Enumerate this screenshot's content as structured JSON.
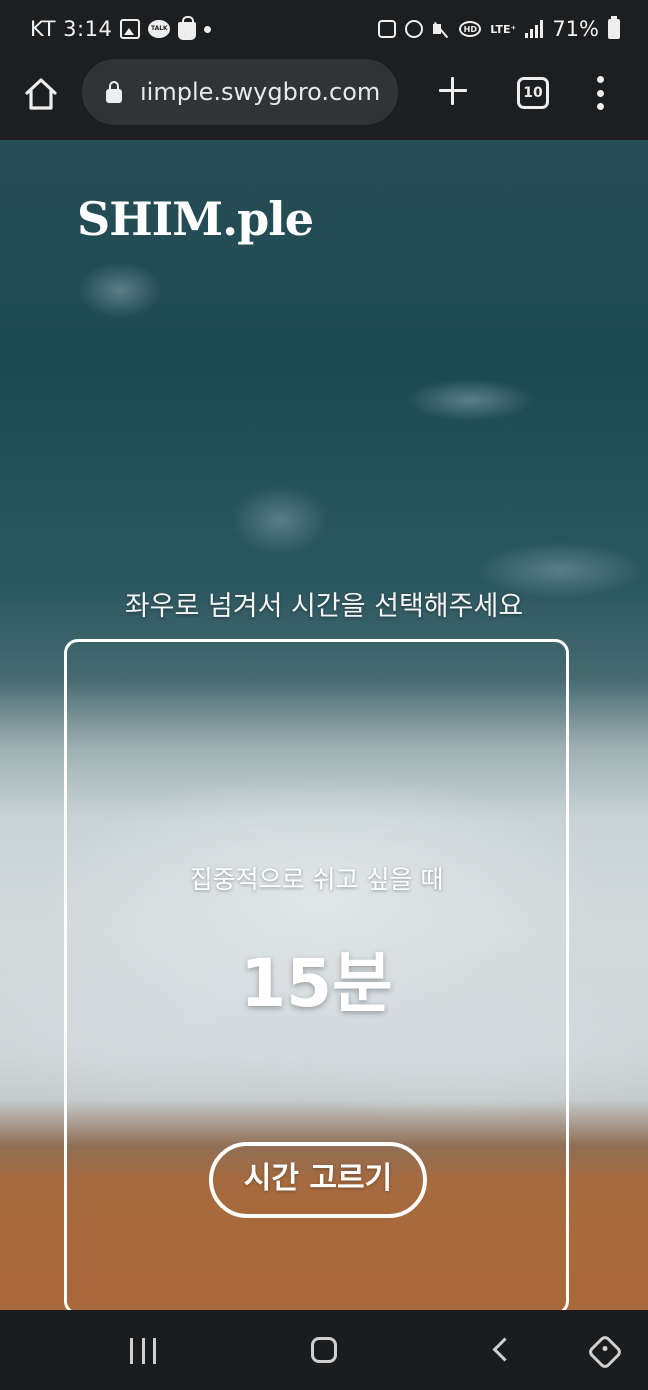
{
  "status_bar": {
    "carrier_time": "KT 3:14",
    "talk_label": "TALK",
    "hd_label": "HD",
    "network_label": "LTE⁺",
    "battery": "71%"
  },
  "browser": {
    "url": "ıimple.swygbro.com",
    "tab_count": "10"
  },
  "page": {
    "logo": "SHIM.ple",
    "instruction": "좌우로 넘겨서 시간을 선택해주세요",
    "card": {
      "subtitle": "집중적으로 쉬고 싶을 때",
      "duration": "15분",
      "button_label": "시간 고르기"
    }
  },
  "icons": [
    "home-icon",
    "lock-icon",
    "plus-icon",
    "tabs-icon",
    "menu-icon",
    "recent-apps-icon",
    "nav-home-icon",
    "back-icon",
    "rotate-icon"
  ]
}
